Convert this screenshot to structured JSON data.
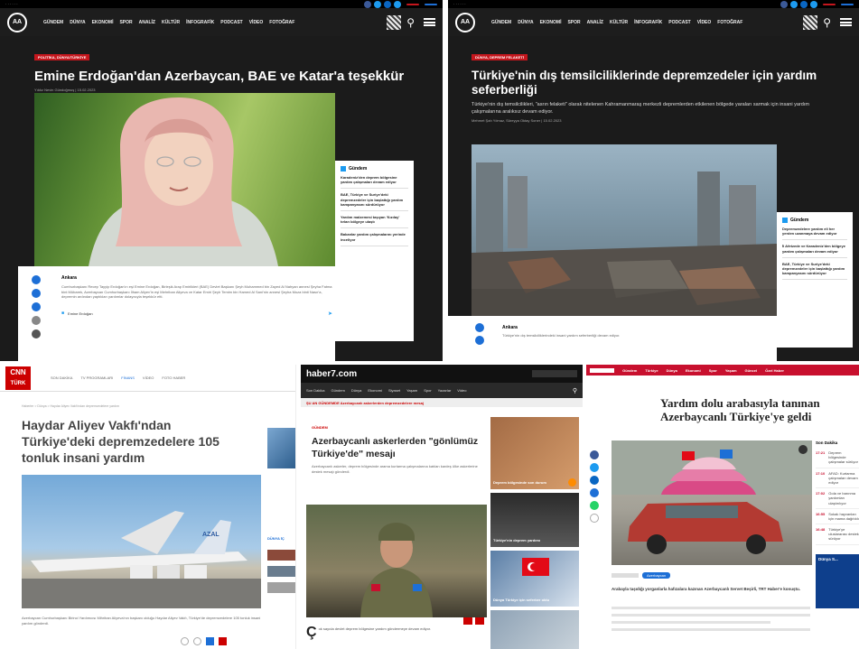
{
  "p1": {
    "categories": [
      "GÜNDEM",
      "DÜNYA",
      "EKONOMİ",
      "SPOR",
      "ANALİZ",
      "KÜLTÜR",
      "İNFOGRAFİK",
      "PODCAST",
      "VİDEO",
      "FOTOĞRAF"
    ],
    "cat_label": "POLİTİKA, DÜNYA/TÜRKİYE",
    "headline": "Emine Erdoğan'dan Azerbaycan, BAE ve Katar'a teşekkür",
    "byline": "Yıldız Nevin Gündoğmuş  |  15.02.2023",
    "location": "Ankara",
    "body": "Cumhurbaşkanı Recep Tayyip Erdoğan'ın eşi Emine Erdoğan, Birleşik Arap Emirlikleri (BAE) Devlet Başkanı Şeyh Muhammed bin Zayed Al Nahyan annesi Şeyha Fatma bint Mübarek, Azerbaycan Cumhurbaşkanı İlham Aliyev'in eşi Mehriban Aliyeva ve Katar Emiri Şeyh Temim bin Hamed Al Sani'nin annesi Şeyha Moza binti Nasır'a, depremin ardından yaptıkları yardımlar dolayısıyla teşekkür etti.",
    "signature": "Emine Erdoğan",
    "sidebar_title": "Gündem",
    "sidebar": [
      "Karadeniz'den deprem bölgesine yardım çalışmaları devam ediyor",
      "BAE, Türkiye ve Suriye'deki depremzedeler için başlattığı yardım kampanyasını sürdürüyor",
      "Yardım malzemesi taşıyan 'Kızılay' tırları bölgeye ulaştı",
      "Bakanlar yardım çalışmalarını yerinde inceliyor"
    ]
  },
  "p2": {
    "categories": [
      "GÜNDEM",
      "DÜNYA",
      "EKONOMİ",
      "SPOR",
      "ANALİZ",
      "KÜLTÜR",
      "İNFOGRAFİK",
      "PODCAST",
      "VİDEO",
      "FOTOĞRAF"
    ],
    "cat_label": "DÜNYA, DEPREM FELAKETİ",
    "headline": "Türkiye'nin dış temsilciliklerinde depremzedeler için yardım seferberliği",
    "summary": "Türkiye'nin dış temsilcilikleri, \"asrın felaketi\" olarak nitelenen Kahramanmaraş merkezli depremlerden etkilenen bölgede yaraları sarmak için insani yardım çalışmalarına aralıksız devam ediyor.",
    "byline": "Mehmet Şah Yılmaz, Süreyya Oktay Soner  |  15.02.2023",
    "location": "Ankara",
    "body": "Türkiye'nin dış temsilciliklerindeki insani yardım seferberliği devam ediyor.",
    "sidebar_title": "Gündem",
    "sidebar": [
      "Depremzedelere yardım eli her yerden uzanmaya devam ediyor",
      "İl Afetzede ve Karadeniz'den bölgeye yardım çalışmaları devam ediyor",
      "BAE, Türkiye ve Suriye'deki depremzedeler için başlattığı yardım kampanyasını sürdürüyor"
    ]
  },
  "p3": {
    "logo_top": "CNN",
    "logo_bottom": "TÜRK",
    "menu": [
      "SON DAKİKA",
      "TV PROGRAMLARI",
      "FİNANS",
      "VİDEO",
      "FOTO HABER"
    ],
    "breadcrumb": "Haberler > Dünya > Haydar Aliyev Vakfı'ndan depremzedelere yardım",
    "headline": "Haydar Aliyev Vakfı'ndan Türkiye'deki depremzedelere 105 tonluk insani yardım",
    "plane_logo": "AZAL",
    "side_label": "DÜNYA İÇ",
    "body": "Azerbaycan Cumhurbaşkanı Birinci Yardımcısı Mihriban Aliyeva'nın başkanı olduğu Haydar Aliyev Vakfı, Türkiye'de depremzedelere 105 tonluk insani yardım gönderdi."
  },
  "p4": {
    "logo": "haber7.com",
    "nav": [
      "Son Dakika",
      "Gündem",
      "Dünya",
      "Ekonomi",
      "Siyaset",
      "Yaşam",
      "Spor",
      "Yazarlar",
      "Video"
    ],
    "ticker": "ŞU AN GÜNDEMDE   Azerbaycanlı askerlerden depremzedelere mesaj",
    "cat_label": "GÜNDEM",
    "headline": "Azerbaycanlı askerlerden \"gönlümüz Türkiye'de\" mesajı",
    "summary": "Azerbaycanlı askerler, deprem bölgesinde arama kurtarma çalışmalarına katılan kardeş ülke askerlerine destek mesajı gönderdi.",
    "thumbs": [
      "Deprem bölgesinde son durum",
      "Türkiye'nin deprem yardımı",
      "Dünya Türkiye için seferber oldu"
    ],
    "dropcap": "Ç",
    "body_tail": "ok sayıda devlet deprem bölgesine yardım göndermeye devam ediyor."
  },
  "p5": {
    "logo": "TRT HABER",
    "menu": [
      "Gündem",
      "Türkiye",
      "Dünya",
      "Ekonomi",
      "Spor",
      "Yaşam",
      "Güncel",
      "Özel Haber"
    ],
    "headline1": "Yardım dolu arabasıyla tanınan",
    "headline2": "Azerbaycanlı Türkiye'ye geldi",
    "sidebar_title": "Son Dakika",
    "news": [
      {
        "time": "17:21",
        "text": "Deprem bölgesinde çalışmalar sürüyor"
      },
      {
        "time": "17:10",
        "text": "AFAD: Kurtarma çalışmaları devam ediyor"
      },
      {
        "time": "17:02",
        "text": "Gıda ve barınma yardımları ulaştırılıyor"
      },
      {
        "time": "16:55",
        "text": "Sokak hayvanları için mama dağıtıldı"
      },
      {
        "time": "16:48",
        "text": "Türkiye'ye uluslararası destek sürüyor"
      }
    ],
    "tag": "Azerbaycan",
    "caption": "Arabayla taşıdığı yorganlarla hafızalara kazınan Azerbaycanlı Servet Beşirli, TRT Haber'e konuştu.",
    "promo": "Dünya S..."
  }
}
